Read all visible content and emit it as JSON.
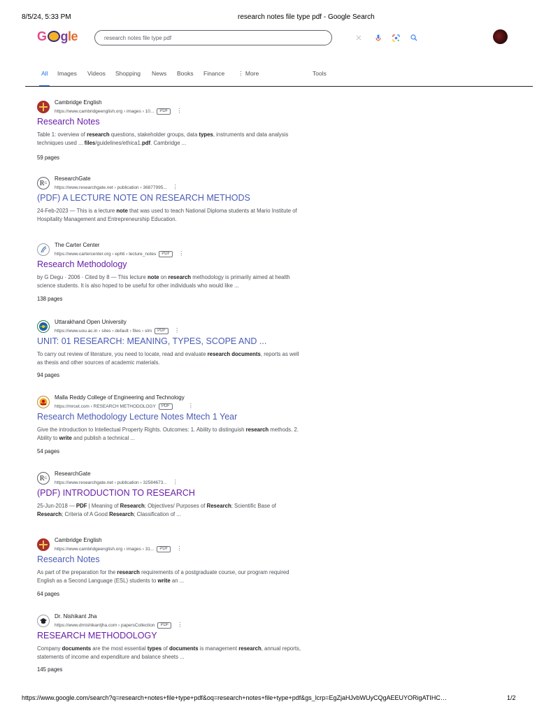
{
  "print_header": {
    "datetime": "8/5/24, 5:33 PM",
    "page_title": "research notes file type pdf - Google Search"
  },
  "search": {
    "query": "research notes file type pdf",
    "logo_text": "Google"
  },
  "icons": {
    "clear": "close-icon",
    "mic": "microphone-icon",
    "lens": "google-lens-icon",
    "search": "search-icon"
  },
  "tabs": [
    {
      "label": "All"
    },
    {
      "label": "Images"
    },
    {
      "label": "Videos"
    },
    {
      "label": "Shopping"
    },
    {
      "label": "News"
    },
    {
      "label": "Books"
    },
    {
      "label": "Finance"
    },
    {
      "label": "More"
    },
    {
      "label": "Tools"
    }
  ],
  "results": [
    {
      "site": "Cambridge English",
      "url": "https://www.cambridgeenglish.org › images › 10...",
      "pdf": "PDF",
      "title": "Research Notes",
      "snippet": "Table 1: overview of research questions, stakeholder groups, data types, instruments and data analysis techniques used ... files/guidelines/ethica1.pdf. Cambridge ...",
      "pages": "59 pages"
    },
    {
      "site": "ResearchGate",
      "url": "https://www.researchgate.net › publication › 36877995...",
      "pdf": "",
      "title": "(PDF) A LECTURE NOTE ON RESEARCH METHODS",
      "snippet": "24-Feb-2023 — This is a lecture note that was used to teach National Diploma students at Mario Institute of Hospitality Management and Entrepreneurship Education.",
      "pages": ""
    },
    {
      "site": "The Carter Center",
      "url": "https://www.cartercenter.org › ephti › lecture_notes",
      "pdf": "PDF",
      "title": "Research Methodology",
      "snippet": "by G Degu · 2006 · Cited by 8 — This lecture note on research methodology is primarily aimed at health science students. It is also hoped to be useful for other individuals who would like ...",
      "pages": "138 pages"
    },
    {
      "site": "Uttarakhand Open University",
      "url": "https://www.uou.ac.in › sites › default › files › slm",
      "pdf": "PDF",
      "title": "UNIT: 01 RESEARCH: MEANING, TYPES, SCOPE AND ...",
      "snippet": "To carry out review of literature, you need to locate, read and evaluate research documents, reports as well as thesis and other sources of academic materials.",
      "pages": "94 pages"
    },
    {
      "site": "Malla Reddy College of Engineering and Technology",
      "url": "https://mrcet.com › RESEARCH METHODOLOGY",
      "pdf": "PDF",
      "title": "Research Methodology Lecture Notes Mtech 1 Year",
      "snippet": "Give the introduction to Intellectual Property Rights. Outcomes: 1. Ability to distinguish research methods. 2. Ability to write and publish a technical ...",
      "pages": "54 pages"
    },
    {
      "site": "ResearchGate",
      "url": "https://www.researchgate.net › publication › 32584673...",
      "pdf": "",
      "title": "(PDF) INTRODUCTION TO RESEARCH",
      "snippet": "25-Jun-2018 — PDF | Meaning of Research; Objectives/ Purposes of Research; Scientific Base of Research; Criteria of A Good Research; Classification of ...",
      "pages": ""
    },
    {
      "site": "Cambridge English",
      "url": "https://www.cambridgeenglish.org › images › 31...",
      "pdf": "PDF",
      "title": "Research Notes",
      "snippet": "As part of the preparation for the research requirements of a postgraduate course, our program required English as a Second Language (ESL) students to write an ...",
      "pages": "64 pages"
    },
    {
      "site": "Dr. Nishikant Jha",
      "url": "https://www.drnishikantjha.com › papersCollection",
      "pdf": "PDF",
      "title": "RESEARCH METHODOLOGY",
      "snippet": "Company documents are the most essential types of documents is management research, annual reports, statements of income and expenditure and balance sheets ...",
      "pages": "145 pages"
    }
  ],
  "footer": {
    "url": "https://www.google.com/search?q=research+notes+file+type+pdf&oq=research+notes+file+type+pdf&gs_lcrp=EgZjaHJvbWUyCQgAEEUYORigATIHC…",
    "page_number": "1/2"
  },
  "colors": {
    "link_visited": "#681da8",
    "link": "#1a0dab",
    "active_tab": "#1a73e8",
    "snippet_text": "#4d5156"
  }
}
